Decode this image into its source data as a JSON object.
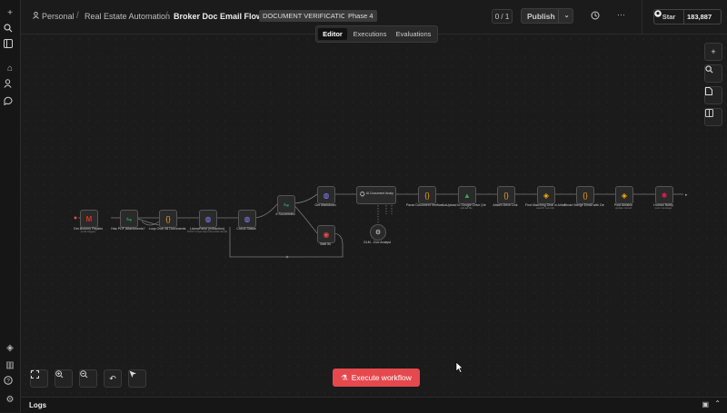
{
  "breadcrumb": {
    "workspace": "Personal",
    "project": "Real Estate Automation",
    "workflow": "Broker Doc Email Flow"
  },
  "tags": [
    "DOCUMENT VERIFICATION",
    "Phase 4"
  ],
  "header": {
    "version_counter": "0 / 1",
    "publish_label": "Publish",
    "star_label": "Star",
    "star_count": "183,887"
  },
  "tabs": [
    "Editor",
    "Executions",
    "Evaluations"
  ],
  "active_tab": "Editor",
  "nodes": [
    {
      "id": "n1",
      "label": "Get Brokers Replies",
      "sub": "(mail trigger)",
      "icon": "gmail-icon",
      "color": "#d93025"
    },
    {
      "id": "n2",
      "label": "Has PDF Attachments?",
      "sub": "",
      "icon": "filter-icon",
      "color": "#26a269"
    },
    {
      "id": "n3",
      "label": "Loop Over All Documents",
      "sub": "",
      "icon": "code-braces-icon",
      "color": "#f0a020"
    },
    {
      "id": "n4",
      "label": "LlamaParse (extraction)",
      "sub": "POST: https://api.cloud.llamaindex",
      "icon": "globe-icon",
      "color": "#8a7cff"
    },
    {
      "id": "n5",
      "label": "Check Status",
      "sub": "",
      "icon": "globe-icon",
      "color": "#8a7cff"
    },
    {
      "id": "n6",
      "label": "If Succeeded",
      "sub": "",
      "icon": "filter-icon",
      "color": "#26a269"
    },
    {
      "id": "n7",
      "label": "Get Markdown",
      "sub": "",
      "icon": "globe-icon",
      "color": "#8a7cff"
    },
    {
      "id": "n8",
      "label": "Wait 5s",
      "sub": "",
      "icon": "wait-icon",
      "color": "#e5484d"
    },
    {
      "id": "n9",
      "label": "AI Document Analyst",
      "sub": "",
      "icon": "robot-icon",
      "color": "#dddddd"
    },
    {
      "id": "n10",
      "label": "GLM - Doc Analyst",
      "sub": "",
      "icon": "gear-icon",
      "color": "#dddddd"
    },
    {
      "id": "n11",
      "label": "Parse Document Verification Result",
      "sub": "",
      "icon": "code-braces-icon",
      "color": "#f0a020"
    },
    {
      "id": "n12",
      "label": "Upload to Google Drive (Verified)",
      "sub": "upload file",
      "icon": "drive-icon",
      "color": "#34a853"
    },
    {
      "id": "n13",
      "label": "Attach Drive Link",
      "sub": "",
      "icon": "code-braces-icon",
      "color": "#f0a020"
    },
    {
      "id": "n14",
      "label": "Find Matching Deal in Airtable",
      "sub": "search records",
      "icon": "airtable-icon",
      "color": "#fcb400"
    },
    {
      "id": "n15",
      "label": "Smart Merge Email with Deal Airtable Base",
      "sub": "",
      "icon": "code-braces-icon",
      "color": "#f0a020"
    },
    {
      "id": "n16",
      "label": "Post Airtable",
      "sub": "update record",
      "icon": "airtable-icon",
      "color": "#fcb400"
    },
    {
      "id": "n17",
      "label": "Human Notify",
      "sub": "post message",
      "icon": "slack-icon",
      "color": "#e01e5a"
    }
  ],
  "execute_label": "Execute workflow",
  "logs_label": "Logs"
}
